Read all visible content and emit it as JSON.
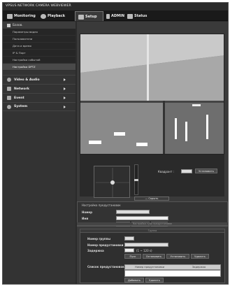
{
  "app": {
    "brand": "VPSUS NETWORK CAMERA WEBVIEWER"
  },
  "nav": {
    "monitoring": "Monitoring",
    "playback": "Playback",
    "setup": "Setup",
    "admin": "ADMIN",
    "status": "Status"
  },
  "sidebar": {
    "basic": "Базов.",
    "sub_items": [
      "Параметры видео",
      "Пользователи",
      "Дата и время",
      "IP & Порт",
      "Настройка событий",
      "Настройка DPTZ"
    ],
    "active_index": 5,
    "categories": [
      "Video & Audio",
      "Network",
      "Event",
      "System"
    ]
  },
  "controls": {
    "quadrant_label": "Квадрант :",
    "set_label": "Установить",
    "hide_label": "— Скрыть"
  },
  "preset": {
    "title": "Настройка предустановок",
    "number_label": "Номер",
    "name_label": "Имя",
    "buttons": [
      "Идти",
      "Добавить",
      "Удалить"
    ]
  },
  "group": {
    "title": "Настройка тура предустановок",
    "panel_title": "Группа",
    "group_number_label": "Номер группы",
    "preset_number_label": "Номер предустановки",
    "delay_label": "Задержка",
    "delay_range": "(1 ~ 120 s)",
    "buttons": [
      "Пуск",
      "Остановить",
      "Установить",
      "Удалить"
    ],
    "list_label": "Список предустановок",
    "list_headers": [
      "Номер предустановки",
      "Задержка"
    ],
    "list_buttons": [
      "Добавить",
      "Удалить"
    ]
  },
  "colors": {
    "frame": "#2b2b2b",
    "navbar": "#1a1a1a",
    "panel": "#333333"
  }
}
